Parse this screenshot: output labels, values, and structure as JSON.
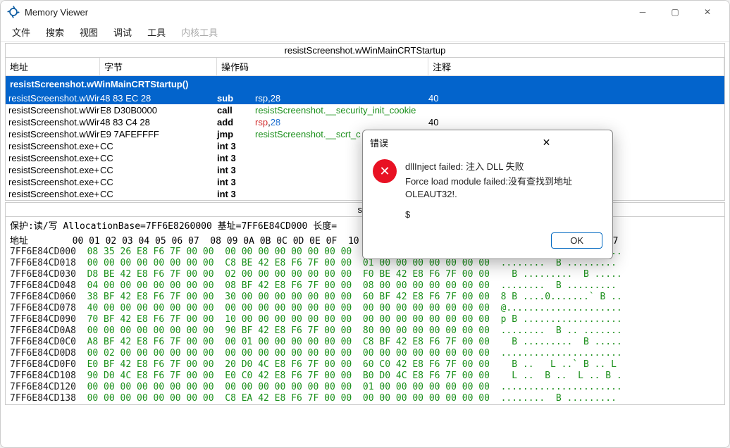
{
  "window": {
    "title": "Memory Viewer"
  },
  "menu": [
    "文件",
    "搜索",
    "视图",
    "调试",
    "工具",
    "内核工具"
  ],
  "pane_title": "resistScreenshot.wWinMainCRTStartup",
  "disasm_headers": {
    "addr": "地址",
    "bytes": "字节",
    "op": "操作码",
    "ann": "注释"
  },
  "func_header": "resistScreenshot.wWinMainCRTStartup()",
  "rows": [
    {
      "sel": true,
      "addr": "resistScreenshot.wWir",
      "bytes": "48 83 EC 28",
      "mnem": "sub",
      "op_pre": "rsp,",
      "op_val": "28",
      "ann": "40"
    },
    {
      "sel": false,
      "addr": "resistScreenshot.wWir",
      "bytes": "E8 D30B0000",
      "mnem": "call",
      "op_green": "resistScreenshot.__security_init_cookie",
      "ann": ""
    },
    {
      "sel": false,
      "addr": "resistScreenshot.wWir",
      "bytes": "48 83 C4 28",
      "mnem": "add",
      "op_pre": "rsp,",
      "op_val": "28",
      "ann": "40"
    },
    {
      "sel": false,
      "addr": "resistScreenshot.wWir",
      "bytes": "E9 7AFEFFFF",
      "mnem": "jmp",
      "op_green": "resistScreenshot.__scrt_c",
      "ann": ""
    },
    {
      "sel": false,
      "addr": "resistScreenshot.exe+",
      "bytes": "CC",
      "mnem": "int 3",
      "op": "",
      "ann": ""
    },
    {
      "sel": false,
      "addr": "resistScreenshot.exe+",
      "bytes": "CC",
      "mnem": "int 3",
      "op": "",
      "ann": ""
    },
    {
      "sel": false,
      "addr": "resistScreenshot.exe+",
      "bytes": "CC",
      "mnem": "int 3",
      "op": "",
      "ann": ""
    },
    {
      "sel": false,
      "addr": "resistScreenshot.exe+",
      "bytes": "CC",
      "mnem": "int 3",
      "op": "",
      "ann": ""
    },
    {
      "sel": false,
      "addr": "resistScreenshot.exe+",
      "bytes": "CC",
      "mnem": "int 3",
      "op": "",
      "ann": ""
    }
  ],
  "hex_section_title": "sub",
  "hex_info": "保护:读/写  AllocationBase=7FF6E8260000  基址=7FF6E84CD000  长度=",
  "hex_head_addr": "地址",
  "hex_head_cols": "  00 01 02 03 04 05 06 07  08 09 0A 0B 0C 0D 0E 0F  10 11 12 13 14 15 16 17  0123456789ABCDEF01234567",
  "hex_rows": [
    {
      "a": "7FF6E84CD000",
      "h": "08 35 26 E8 F6 7F 00 00  00 00 00 00 00 00 00 00  00 00 00 00 00 00 00 00",
      "t": ".5& .................."
    },
    {
      "a": "7FF6E84CD018",
      "h": "00 00 00 00 00 00 00 00  C8 BE 42 E8 F6 7F 00 00  01 00 00 00 00 00 00 00",
      "t": "........  B ........."
    },
    {
      "a": "7FF6E84CD030",
      "h": "D8 BE 42 E8 F6 7F 00 00  02 00 00 00 00 00 00 00  F0 BE 42 E8 F6 7F 00 00",
      "t": "  B .........  B ....."
    },
    {
      "a": "7FF6E84CD048",
      "h": "04 00 00 00 00 00 00 00  08 BF 42 E8 F6 7F 00 00  08 00 00 00 00 00 00 00",
      "t": "........  B ........."
    },
    {
      "a": "7FF6E84CD060",
      "h": "38 BF 42 E8 F6 7F 00 00  30 00 00 00 00 00 00 00  60 BF 42 E8 F6 7F 00 00",
      "t": "8 B ....0.......` B .."
    },
    {
      "a": "7FF6E84CD078",
      "h": "40 00 00 00 00 00 00 00  00 00 00 00 00 00 00 00  00 00 00 00 00 00 00 00",
      "t": "@....................."
    },
    {
      "a": "7FF6E84CD090",
      "h": "70 BF 42 E8 F6 7F 00 00  10 00 00 00 00 00 00 00  00 00 00 00 00 00 00 00",
      "t": "p B .................."
    },
    {
      "a": "7FF6E84CD0A8",
      "h": "00 00 00 00 00 00 00 00  90 BF 42 E8 F6 7F 00 00  80 00 00 00 00 00 00 00",
      "t": "........  B .. ......."
    },
    {
      "a": "7FF6E84CD0C0",
      "h": "A8 BF 42 E8 F6 7F 00 00  00 01 00 00 00 00 00 00  C8 BF 42 E8 F6 7F 00 00",
      "t": "  B .........  B ....."
    },
    {
      "a": "7FF6E84CD0D8",
      "h": "00 02 00 00 00 00 00 00  00 00 00 00 00 00 00 00  00 00 00 00 00 00 00 00",
      "t": "......................"
    },
    {
      "a": "7FF6E84CD0F0",
      "h": "E0 BF 42 E8 F6 7F 00 00  20 D0 4C E8 F6 7F 00 00  60 C0 42 E8 F6 7F 00 00",
      "t": "  B ..   L ..` B .. L "
    },
    {
      "a": "7FF6E84CD108",
      "h": "90 D0 4C E8 F6 7F 00 00  E0 C0 42 E8 F6 7F 00 00  B0 D0 4C E8 F6 7F 00 00",
      "t": "  L ..  B ..  L .. B ."
    },
    {
      "a": "7FF6E84CD120",
      "h": "00 00 00 00 00 00 00 00  00 00 00 00 00 00 00 00  01 00 00 00 00 00 00 00",
      "t": "......................"
    },
    {
      "a": "7FF6E84CD138",
      "h": "00 00 00 00 00 00 00 00  C8 EA 42 E8 F6 7F 00 00  00 00 00 00 00 00 00 00",
      "t": "........  B ........."
    }
  ],
  "modal": {
    "title": "错误",
    "line1": "dllInject failed: 注入 DLL 失败",
    "line2": "Force load module failed:没有查找到地址",
    "line3": "OLEAUT32!.",
    "line4": "$",
    "ok": "OK"
  }
}
